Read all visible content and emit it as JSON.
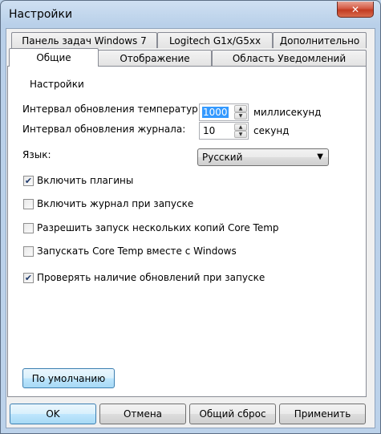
{
  "window": {
    "title": "Настройки",
    "close_glyph": "✕"
  },
  "tabs_row1": [
    "Панель задач Windows 7",
    "Logitech G1x/G5xx",
    "Дополнительно"
  ],
  "tabs_row2": [
    "Общие",
    "Отображение",
    "Область Уведомлений"
  ],
  "active_tab": "Общие",
  "group": {
    "label": "Настройки"
  },
  "temp_interval": {
    "label": "Интервал обновления температур:",
    "value": "1000",
    "unit": "миллисекунд"
  },
  "log_interval": {
    "label": "Интервал обновления журнала:",
    "value": "10",
    "unit": "секунд"
  },
  "language": {
    "label": "Язык:",
    "value": "Русский"
  },
  "checkboxes": [
    {
      "label": "Включить плагины",
      "checked": true
    },
    {
      "label": "Включить журнал при запуске",
      "checked": false
    },
    {
      "label": "Разрешить запуск нескольких копий Core Temp",
      "checked": false
    },
    {
      "label": "Запускать Core Temp вместе с Windows",
      "checked": false
    },
    {
      "label": "Проверять наличие обновлений при запуске",
      "checked": true
    }
  ],
  "buttons": {
    "defaults": "По умолчанию",
    "ok": "OK",
    "cancel": "Отмена",
    "reset": "Общий сброс",
    "apply": "Применить"
  }
}
